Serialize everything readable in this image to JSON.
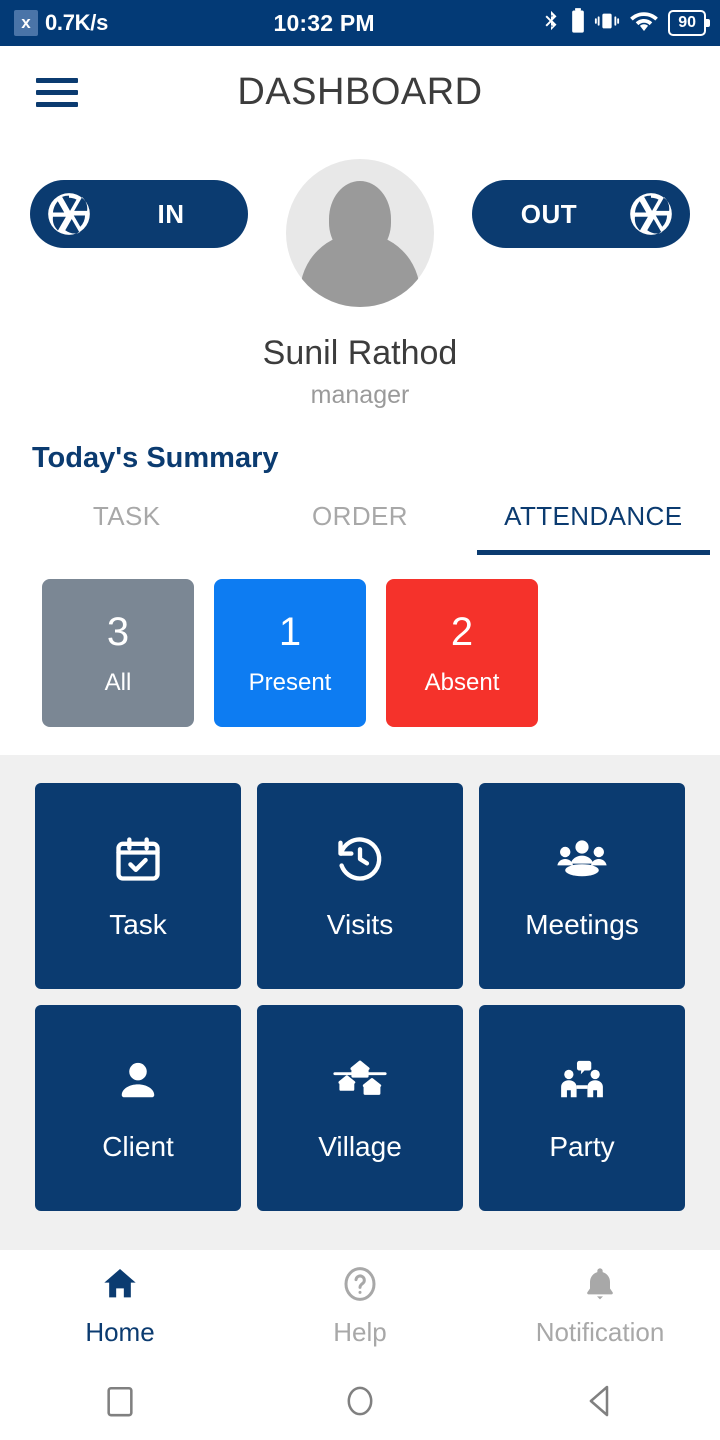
{
  "status_bar": {
    "network_badge": "x",
    "network_speed": "0.7K/s",
    "time": "10:32 PM",
    "icons": [
      "bluetooth-icon",
      "battery-icon",
      "vibrate-icon",
      "wifi-icon"
    ],
    "battery_percent": "90"
  },
  "app_bar": {
    "menu_icon": "hamburger-menu-icon",
    "title": "DASHBOARD"
  },
  "profile": {
    "avatar_icon": "user-avatar-placeholder",
    "name": "Sunil Rathod",
    "role": "manager",
    "punch_in_label": "IN",
    "punch_out_label": "OUT",
    "punch_icon": "camera-aperture-icon"
  },
  "summary": {
    "title": "Today's Summary",
    "tabs": [
      {
        "label": "TASK",
        "active": false
      },
      {
        "label": "ORDER",
        "active": false
      },
      {
        "label": "ATTENDANCE",
        "active": true
      }
    ],
    "stats": [
      {
        "value": "3",
        "label": "All",
        "color": "#7b8794"
      },
      {
        "value": "1",
        "label": "Present",
        "color": "#0d7cf2"
      },
      {
        "value": "2",
        "label": "Absent",
        "color": "#f5322b"
      }
    ]
  },
  "menu_grid": {
    "tiles": [
      {
        "label": "Task",
        "icon": "calendar-check-icon"
      },
      {
        "label": "Visits",
        "icon": "clock-history-icon"
      },
      {
        "label": "Meetings",
        "icon": "people-group-icon"
      },
      {
        "label": "Client",
        "icon": "person-icon"
      },
      {
        "label": "Village",
        "icon": "huts-village-icon"
      },
      {
        "label": "Party",
        "icon": "two-people-talking-icon"
      }
    ]
  },
  "bottom_nav": {
    "items": [
      {
        "label": "Home",
        "icon": "home-icon",
        "active": true
      },
      {
        "label": "Help",
        "icon": "question-circle-icon",
        "active": false
      },
      {
        "label": "Notification",
        "icon": "bell-icon",
        "active": false
      }
    ]
  },
  "system_nav": {
    "recents_icon": "square-recents-icon",
    "home_icon": "circle-home-icon",
    "back_icon": "triangle-back-icon"
  },
  "colors": {
    "primary": "#0b3b70",
    "status_bar": "#033A76",
    "grid_bg": "#f0f0f0"
  }
}
